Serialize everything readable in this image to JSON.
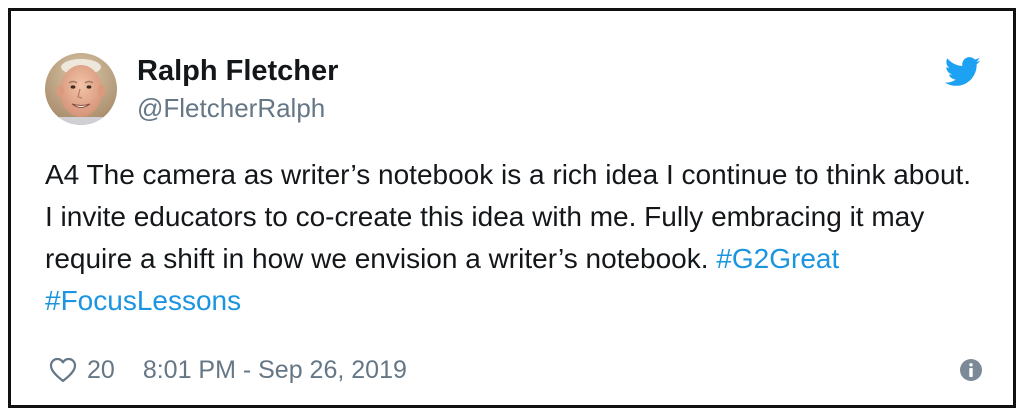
{
  "tweet": {
    "author": {
      "display_name": "Ralph Fletcher",
      "handle": "@FletcherRalph",
      "avatar_icon": "profile-photo"
    },
    "text_segments": [
      {
        "text": "A4  The camera as writer’s notebook is a rich idea I continue to think about. I invite educators to co-create this idea with me. Fully embracing it may require a shift in how we envision a writer’s notebook. ",
        "type": "text"
      },
      {
        "text": "#G2Great",
        "type": "hashtag"
      },
      {
        "text": " ",
        "type": "text"
      },
      {
        "text": "#FocusLessons",
        "type": "hashtag"
      }
    ],
    "likes": "20",
    "timestamp": "8:01 PM - Sep 26, 2019",
    "icons": {
      "brand": "twitter-bird-icon",
      "like": "heart-icon",
      "info": "info-icon"
    }
  },
  "colors": {
    "twitter_blue": "#1da1f2",
    "hashtag": "#1b95e0",
    "secondary_text": "#657786",
    "primary_text": "#14171a"
  }
}
